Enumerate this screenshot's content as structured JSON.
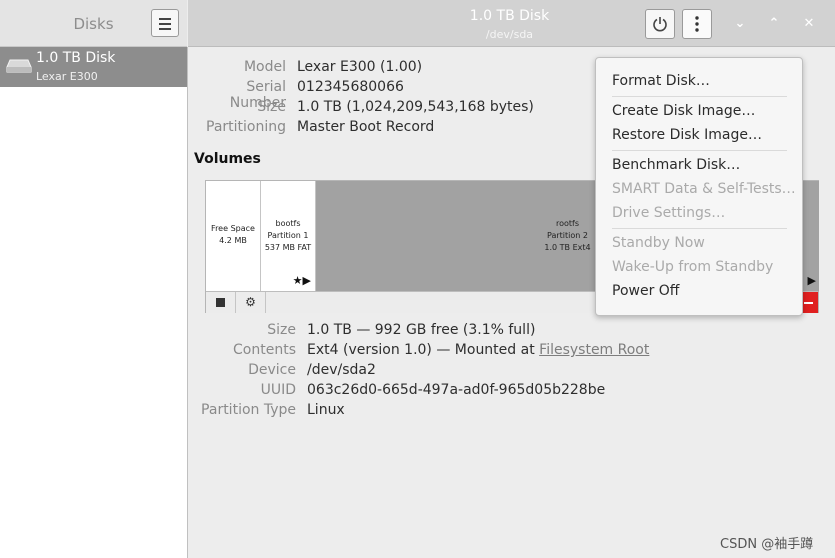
{
  "sidebar": {
    "title": "Disks",
    "disk": {
      "name": "1.0 TB Disk",
      "model": "Lexar E300"
    }
  },
  "header": {
    "title": "1.0 TB Disk",
    "subtitle": "/dev/sda"
  },
  "drive_info": [
    {
      "label": "Model",
      "value": "Lexar E300 (1.00)"
    },
    {
      "label": "Serial Number",
      "value": "012345680066"
    },
    {
      "label": "Size",
      "value": "1.0 TB (1,024,209,543,168 bytes)"
    },
    {
      "label": "Partitioning",
      "value": "Master Boot Record"
    }
  ],
  "volumes_heading": "Volumes",
  "partitions": {
    "free": {
      "line1": "Free Space",
      "line2": "4.2 MB"
    },
    "boot": {
      "line1": "bootfs",
      "line2": "Partition 1",
      "line3": "537 MB FAT",
      "flags": "★▶"
    },
    "root": {
      "line1": "rootfs",
      "line2": "Partition 2",
      "line3": "1.0 TB Ext4",
      "flags": "▶"
    }
  },
  "partition_info": {
    "size": {
      "label": "Size",
      "value": "1.0 TB — 992 GB free (3.1% full)"
    },
    "contents": {
      "label": "Contents",
      "value": "Ext4 (version 1.0) — Mounted at ",
      "link": "Filesystem Root"
    },
    "device": {
      "label": "Device",
      "value": "/dev/sda2"
    },
    "uuid": {
      "label": "UUID",
      "value": "063c26d0-665d-497a-ad0f-965d05b228be"
    },
    "type": {
      "label": "Partition Type",
      "value": "Linux"
    }
  },
  "menu": {
    "format": "Format Disk…",
    "create_image": "Create Disk Image…",
    "restore_image": "Restore Disk Image…",
    "benchmark": "Benchmark Disk…",
    "smart": "SMART Data & Self-Tests…",
    "drive_settings": "Drive Settings…",
    "standby": "Standby Now",
    "wakeup": "Wake-Up from Standby",
    "power_off": "Power Off"
  },
  "watermark": "CSDN @袖手蹲",
  "colors": {
    "selection": "#8d8d8d",
    "partition_selected": "#a2a2a2",
    "danger": "#e02020"
  },
  "icons": [
    "hamburger-menu-icon",
    "power-icon",
    "kebab-menu-icon",
    "minimize-icon",
    "maximize-icon",
    "close-icon",
    "stop-icon",
    "gears-icon",
    "drive-icon"
  ]
}
